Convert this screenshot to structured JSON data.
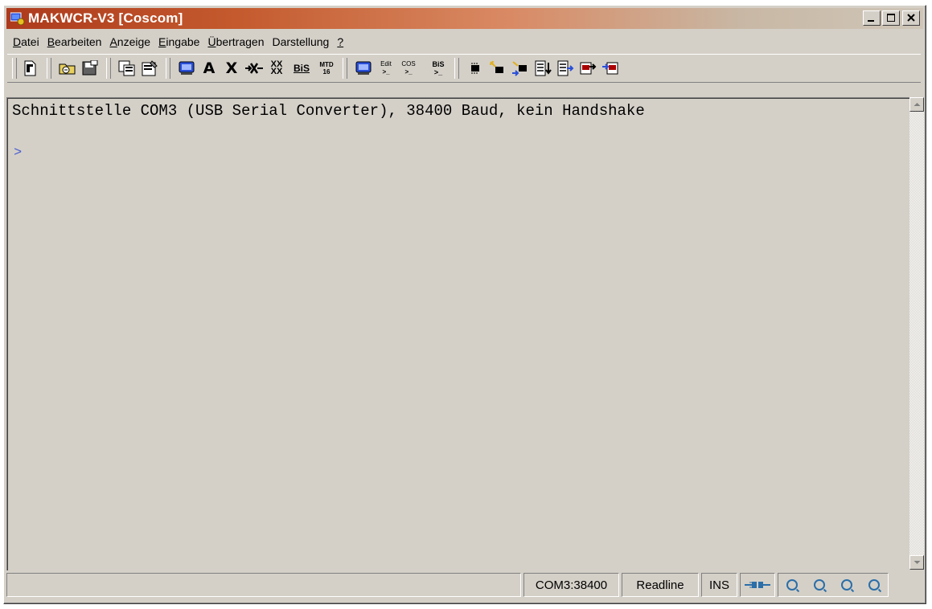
{
  "window": {
    "title": "MAKWCR-V3 [Coscom]",
    "title_gradient_start": "#ad3a1c",
    "caption_buttons": [
      "minimize-icon",
      "maximize-icon",
      "close-icon"
    ]
  },
  "menu": [
    {
      "label": "Datei",
      "accel": "D",
      "rest": "atei"
    },
    {
      "label": "Bearbeiten",
      "accel": "B",
      "rest": "earbeiten"
    },
    {
      "label": "Anzeige",
      "accel": "A",
      "rest": "nzeige"
    },
    {
      "label": "Eingabe",
      "accel": "E",
      "rest": "ingabe"
    },
    {
      "label": "Übertragen",
      "accel": "Ü",
      "rest": "bertragen"
    },
    {
      "label": "Darstellung",
      "accel": "",
      "rest": "Darstellung"
    },
    {
      "label": "?",
      "accel": "?",
      "rest": ""
    }
  ],
  "toolbar": {
    "text_buttons": {
      "a": "A",
      "x": "X",
      "xx": "XX",
      "bis": "BiS",
      "mtd": "MTD",
      "mtd_sub": "16",
      "edit": "Edit",
      "cos": "COS",
      "bis2": "BiS"
    }
  },
  "terminal": {
    "status_line": "Schnittstelle COM3 (USB Serial Converter), 38400 Baud, kein Handshake",
    "prompt": ">",
    "prompt_color": "#4a5fd0"
  },
  "statusbar": {
    "port": "COM3:38400",
    "mode": "Readline",
    "insert": "INS",
    "plug_icon": "plug-icon",
    "led_icons": [
      "led-1-icon",
      "led-2-icon",
      "led-3-icon",
      "led-4-icon"
    ],
    "accent": "#2b6ea8"
  }
}
